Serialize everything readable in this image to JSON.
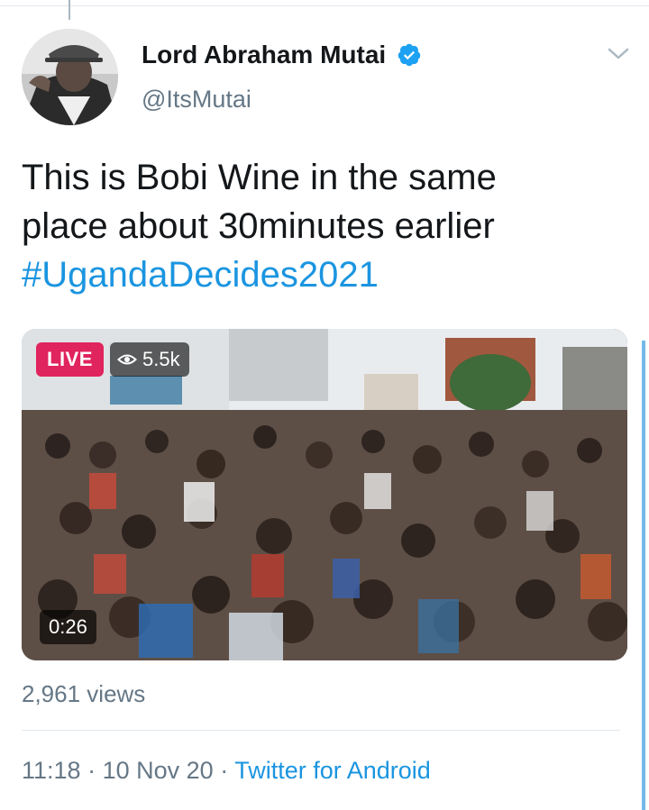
{
  "tweet": {
    "display_name": "Lord Abraham Mutai",
    "handle": "@ItsMutai",
    "verified": true,
    "text_line1": "This is Bobi Wine in the same",
    "text_line2": "place about 30minutes earlier",
    "hashtag": "#UgandaDecides2021",
    "video": {
      "live_label": "LIVE",
      "viewers": "5.5k",
      "duration": "0:26"
    },
    "views": "2,961 views",
    "time": "11:18",
    "separator": "·",
    "date": "10 Nov 20",
    "source": "Twitter for Android"
  },
  "colors": {
    "link": "#1b95e0",
    "secondary_text": "#657786",
    "live_badge": "#e0245e",
    "verified": "#1da1f2"
  },
  "icons": {
    "verified": "verified-badge-icon",
    "more": "chevron-down-icon",
    "viewers": "eye-icon"
  }
}
